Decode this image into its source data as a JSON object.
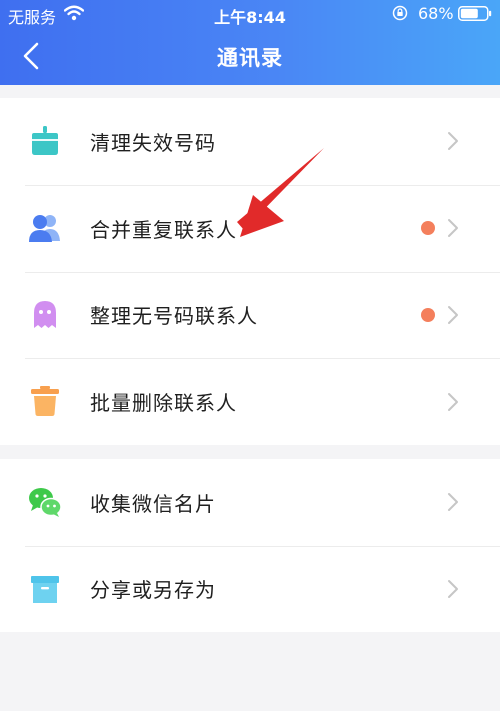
{
  "status_bar": {
    "carrier": "无服务",
    "time": "上午8:44",
    "battery_percent": "68%",
    "battery_level": 0.68
  },
  "nav": {
    "title": "通讯录"
  },
  "colors": {
    "header_gradient_start": "#3f6ff0",
    "header_gradient_end": "#4aa6f8",
    "badge": "#f47f5c",
    "annotation_arrow": "#e12a2a"
  },
  "menu_group_1": [
    {
      "label": "清理失效号码",
      "icon": "broom-icon",
      "icon_color": "#3cc6c6",
      "badge": false
    },
    {
      "label": "合并重复联系人",
      "icon": "contacts-icon",
      "icon_color": "#5b8ef2",
      "badge": true
    },
    {
      "label": "整理无号码联系人",
      "icon": "ghost-icon",
      "icon_color": "#d18ef0",
      "badge": true
    },
    {
      "label": "批量删除联系人",
      "icon": "trash-icon",
      "icon_color": "#f8a04e",
      "badge": false
    }
  ],
  "menu_group_2": [
    {
      "label": "收集微信名片",
      "icon": "wechat-icon",
      "icon_color": "#3ec94a",
      "badge": false
    },
    {
      "label": "分享或另存为",
      "icon": "archive-box-icon",
      "icon_color": "#4fc4ea",
      "badge": false
    }
  ]
}
